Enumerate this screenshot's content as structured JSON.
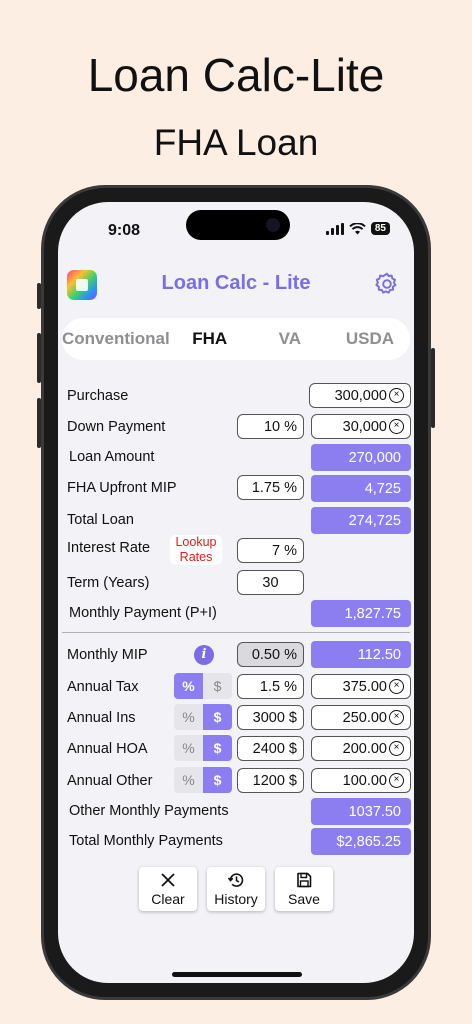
{
  "promo": {
    "title": "Loan Calc-Lite",
    "subtitle": "FHA Loan"
  },
  "status": {
    "time": "9:08",
    "battery": "85"
  },
  "app": {
    "title": "Loan Calc - Lite"
  },
  "tabs": [
    {
      "label": "Conventional"
    },
    {
      "label": "FHA"
    },
    {
      "label": "VA"
    },
    {
      "label": "USDA"
    }
  ],
  "active_tab": "FHA",
  "loan": {
    "purchase_label": "Purchase",
    "purchase_value": "300,000",
    "down_payment_label": "Down Payment",
    "down_payment_pct": "10 %",
    "down_payment_value": "30,000",
    "loan_amount_label": "Loan Amount",
    "loan_amount_value": "270,000",
    "mip_label": "FHA Upfront MIP",
    "mip_pct": "1.75 %",
    "mip_value": "4,725",
    "total_loan_label": "Total Loan",
    "total_loan_value": "274,725",
    "interest_label": "Interest Rate",
    "lookup_line1": "Lookup",
    "lookup_line2": "Rates",
    "interest_value": "7 %",
    "term_label": "Term (Years)",
    "term_value": "30",
    "payment_label": "Monthly Payment (P+I)",
    "payment_value": "1,827.75"
  },
  "extras": {
    "monthly_mip_label": "Monthly MIP",
    "monthly_mip_pct": "0.50 %",
    "monthly_mip_value": "112.50",
    "tax_label": "Annual Tax",
    "tax_input": "1.5 %",
    "tax_value": "375.00",
    "ins_label": "Annual Ins",
    "ins_input": "3000 $",
    "ins_value": "250.00",
    "hoa_label": "Annual HOA",
    "hoa_input": "2400 $",
    "hoa_value": "200.00",
    "other_label": "Annual Other",
    "other_input": "1200 $",
    "other_value": "100.00",
    "other_monthly_label": "Other Monthly Payments",
    "other_monthly_value": "1037.50",
    "total_monthly_label": "Total Monthly Payments",
    "total_monthly_value": "$2,865.25",
    "pct_symbol": "%",
    "dollar_symbol": "$",
    "clear_x": "×"
  },
  "actions": {
    "clear": "Clear",
    "history": "History",
    "save": "Save"
  },
  "colors": {
    "accent": "#7b6de6",
    "output": "#8c7ef0",
    "background": "#fdeee4",
    "lookup": "#e01c1c"
  }
}
